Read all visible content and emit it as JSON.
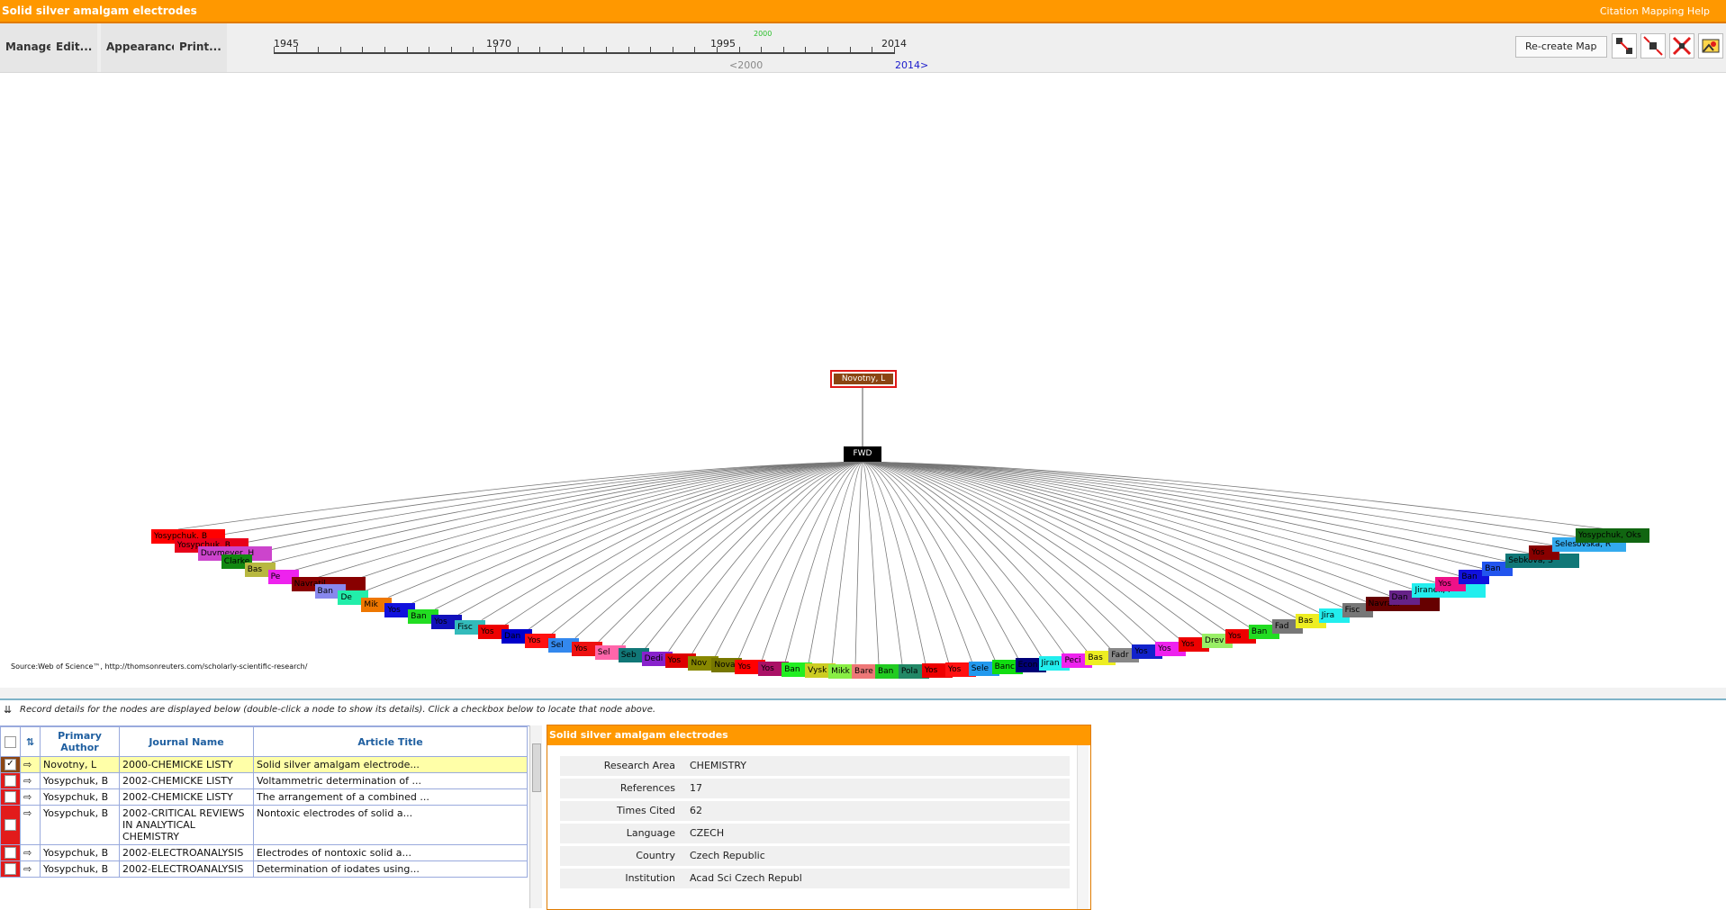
{
  "app": {
    "title": "Solid silver amalgam electrodes",
    "help_label": "Citation Mapping Help"
  },
  "toolbar": {
    "menus": [
      "Manage",
      "Edit...",
      "Appearance",
      "Print..."
    ],
    "recreate_label": "Re-create Map",
    "tools": [
      "expand-nodes-icon",
      "collapse-nodes-icon",
      "reset-layout-icon",
      "export-image-icon"
    ]
  },
  "timeline": {
    "years": [
      "1945",
      "1970",
      "1995",
      "2014"
    ],
    "marker": "2000",
    "left_label": "<2000",
    "right_label": "2014>"
  },
  "map": {
    "root_label": "Novotny, L",
    "fwd_label": "FWD",
    "source": "Source:Web of Science™, http://thomsonreuters.com/scholarly-scientific-research/",
    "nodes": [
      {
        "label": "Yosypchuk, B",
        "color": "#ff0000"
      },
      {
        "label": "Yosypchuk, B",
        "color": "#e8001a"
      },
      {
        "label": "Duvmeyer, H",
        "color": "#cc44cc"
      },
      {
        "label": "Clarke",
        "color": "#118811"
      },
      {
        "label": "Bas",
        "color": "#b8b840"
      },
      {
        "label": "Pe",
        "color": "#ee22ee"
      },
      {
        "label": "Navratil",
        "color": "#880000"
      },
      {
        "label": "Ban",
        "color": "#8888ee"
      },
      {
        "label": "De",
        "color": "#22eeaa"
      },
      {
        "label": "Mik",
        "color": "#ee7700"
      },
      {
        "label": "Yos",
        "color": "#1111dd"
      },
      {
        "label": "Ban",
        "color": "#22dd22"
      },
      {
        "label": "Yos",
        "color": "#1111bb"
      },
      {
        "label": "Fisc",
        "color": "#33bbbb"
      },
      {
        "label": "Yos",
        "color": "#ee0000"
      },
      {
        "label": "Dan",
        "color": "#0000cc"
      },
      {
        "label": "Yos",
        "color": "#ff1111"
      },
      {
        "label": "Sel",
        "color": "#3388ee"
      },
      {
        "label": "Yos",
        "color": "#ee1111"
      },
      {
        "label": "Sel",
        "color": "#ff66aa"
      },
      {
        "label": "Seb",
        "color": "#117777"
      },
      {
        "label": "Dedi",
        "color": "#8822cc"
      },
      {
        "label": "Yos",
        "color": "#dd0000"
      },
      {
        "label": "Nov",
        "color": "#888800"
      },
      {
        "label": "Nova",
        "color": "#777700"
      },
      {
        "label": "Yos",
        "color": "#ff0000"
      },
      {
        "label": "Yos",
        "color": "#aa1166"
      },
      {
        "label": "Ban",
        "color": "#22ee22"
      },
      {
        "label": "Vysk",
        "color": "#cccc22"
      },
      {
        "label": "Mikk",
        "color": "#88ee44"
      },
      {
        "label": "Bare",
        "color": "#ee7777"
      },
      {
        "label": "Ban",
        "color": "#22cc22"
      },
      {
        "label": "Pola",
        "color": "#228866"
      },
      {
        "label": "Yos",
        "color": "#ee0000"
      },
      {
        "label": "Yos",
        "color": "#ff1111"
      },
      {
        "label": "Sele",
        "color": "#2299ee"
      },
      {
        "label": "Banc",
        "color": "#11dd11"
      },
      {
        "label": "Econ",
        "color": "#000077"
      },
      {
        "label": "Jiran",
        "color": "#22eeee"
      },
      {
        "label": "Peci",
        "color": "#ee22ee"
      },
      {
        "label": "Bas",
        "color": "#eeee22"
      },
      {
        "label": "Fadr",
        "color": "#888888"
      },
      {
        "label": "Yos",
        "color": "#1122cc"
      },
      {
        "label": "Yos",
        "color": "#ee22ee"
      },
      {
        "label": "Yos",
        "color": "#ee0000"
      },
      {
        "label": "Drev",
        "color": "#99ee66"
      },
      {
        "label": "Yos",
        "color": "#ee0000"
      },
      {
        "label": "Ban",
        "color": "#22dd22"
      },
      {
        "label": "Fad",
        "color": "#777777"
      },
      {
        "label": "Bas",
        "color": "#eeee22"
      },
      {
        "label": "Jira",
        "color": "#22eeee"
      },
      {
        "label": "Fisc",
        "color": "#777777"
      },
      {
        "label": "Navratil",
        "color": "#660000"
      },
      {
        "label": "Dan",
        "color": "#662288"
      },
      {
        "label": "Jiranek, I",
        "color": "#22eeee"
      },
      {
        "label": "Yos",
        "color": "#ee1188"
      },
      {
        "label": "Ban",
        "color": "#1111dd"
      },
      {
        "label": "Ban",
        "color": "#2255ee"
      },
      {
        "label": "Sebkova, S",
        "color": "#117777"
      },
      {
        "label": "Yos",
        "color": "#880000"
      },
      {
        "label": "Selesovska, R",
        "color": "#33aaee"
      },
      {
        "label": "Yosypchuk, Oks",
        "color": "#116611"
      }
    ]
  },
  "details_bar": {
    "message": "Record details for the nodes are displayed below (double-click a node to show its details). Click a checkbox below to locate that node above."
  },
  "records": {
    "headers": [
      "Primary Author",
      "Journal Name",
      "Article Title"
    ],
    "rows": [
      {
        "author": "Novotny, L",
        "journal": "2000-CHEMICKE LISTY",
        "title": "Solid silver amalgam electrode...",
        "checked": true
      },
      {
        "author": "Yosypchuk, B",
        "journal": "2002-CHEMICKE LISTY",
        "title": "Voltammetric determination of ...",
        "checked": false
      },
      {
        "author": "Yosypchuk, B",
        "journal": "2002-CHEMICKE LISTY",
        "title": "The arrangement of a combined ...",
        "checked": false
      },
      {
        "author": "Yosypchuk, B",
        "journal": "2002-CRITICAL REVIEWS IN ANALYTICAL CHEMISTRY",
        "title": "Nontoxic electrodes of solid a...",
        "checked": false
      },
      {
        "author": "Yosypchuk, B",
        "journal": "2002-ELECTROANALYSIS",
        "title": "Electrodes of nontoxic solid a...",
        "checked": false
      },
      {
        "author": "Yosypchuk, B",
        "journal": "2002-ELECTROANALYSIS",
        "title": "Determination of iodates using...",
        "checked": false
      }
    ]
  },
  "detail": {
    "title": "Solid silver amalgam electrodes",
    "fields": [
      {
        "label": "Research Area",
        "value": "CHEMISTRY"
      },
      {
        "label": "References",
        "value": "17"
      },
      {
        "label": "Times Cited",
        "value": "62"
      },
      {
        "label": "Language",
        "value": "CZECH"
      },
      {
        "label": "Country",
        "value": "Czech Republic"
      },
      {
        "label": "Institution",
        "value": "Acad Sci Czech Republ"
      }
    ]
  }
}
